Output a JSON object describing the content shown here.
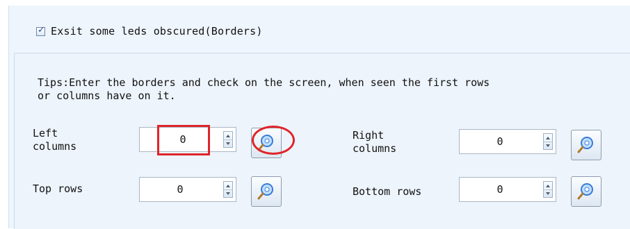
{
  "borders_checkbox": {
    "checked": true,
    "label": "Exsit some leds obscured(Borders)"
  },
  "tips": {
    "text": "Tips:Enter the borders and check on the screen, when seen the first rows\nor columns have on it."
  },
  "fields": {
    "left_columns": {
      "label": "Left\ncolumns",
      "value": "0"
    },
    "right_columns": {
      "label": "Right\ncolumns",
      "value": "0"
    },
    "top_rows": {
      "label": "Top rows",
      "value": "0"
    },
    "bottom_rows": {
      "label": "Bottom rows",
      "value": "0"
    }
  },
  "icons": {
    "spin_up": "triangle-up-icon",
    "spin_down": "triangle-down-icon",
    "pick": "magnifier-locate-icon"
  },
  "colors": {
    "highlight": "#e0242a",
    "panel_bg": "#eef5fc",
    "checkbox_check": "#2c4f9c"
  }
}
